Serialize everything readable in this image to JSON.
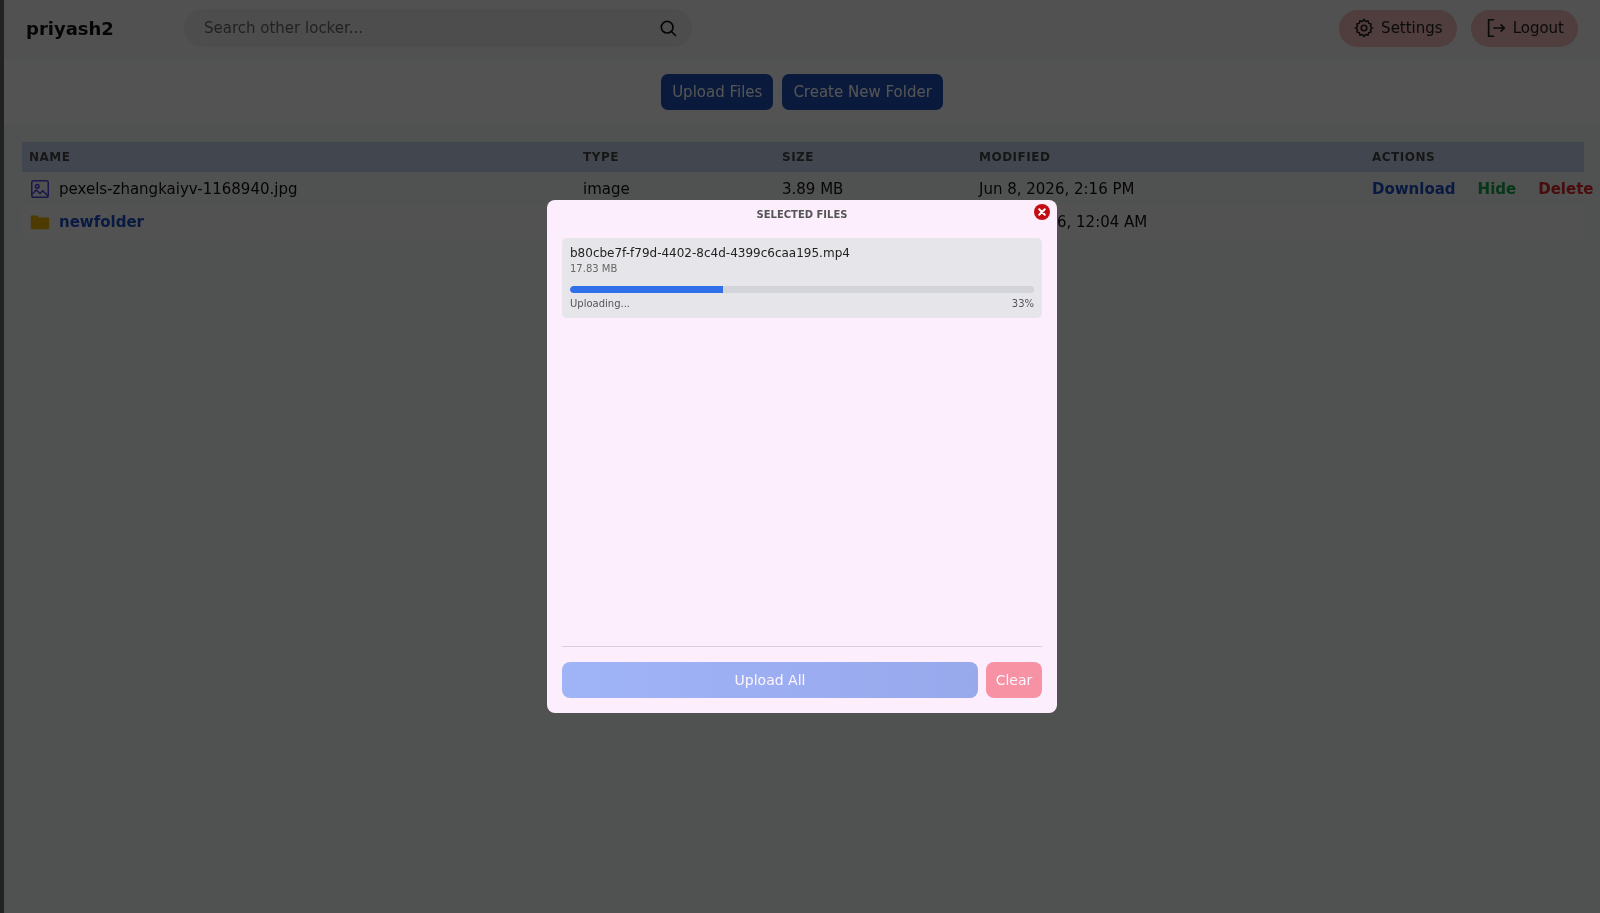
{
  "header": {
    "brand": "priyash2",
    "search": {
      "placeholder": "Search other locker..."
    },
    "buttons": [
      {
        "kind": "settings",
        "label": "Settings"
      },
      {
        "kind": "logout",
        "label": "Logout"
      }
    ]
  },
  "toolbar": {
    "buttons": [
      "Upload Files",
      "Create New Folder"
    ]
  },
  "table": {
    "columns": [
      "NAME",
      "TYPE",
      "SIZE",
      "MODIFIED",
      "ACTIONS"
    ],
    "rows": [
      {
        "kind": "image",
        "name": "pexels-zhangkaiyv-1168940.jpg",
        "type": "image",
        "size": "3.89 MB",
        "modified": "Jun 8, 2026, 2:16 PM",
        "actions": [
          {
            "kind": "download",
            "label": "Download"
          },
          {
            "kind": "hide",
            "label": "Hide"
          },
          {
            "kind": "delete",
            "label": "Delete"
          }
        ]
      },
      {
        "kind": "folder",
        "name": "newfolder",
        "modified": "6, 12:04 AM",
        "modified_cut": true
      }
    ]
  },
  "modal": {
    "title": "SELECTED FILES",
    "files": [
      {
        "name": "b80cbe7f-f79d-4402-8c4d-4399c6caa195.mp4",
        "size": "17.83 MB",
        "status": "Uploading...",
        "percent": "33%",
        "level": 0.33
      }
    ],
    "buttons": [
      {
        "kind": "primary",
        "label": "Upload All",
        "disabled": true
      },
      {
        "kind": "danger",
        "label": "Clear",
        "disabled": true
      }
    ]
  }
}
